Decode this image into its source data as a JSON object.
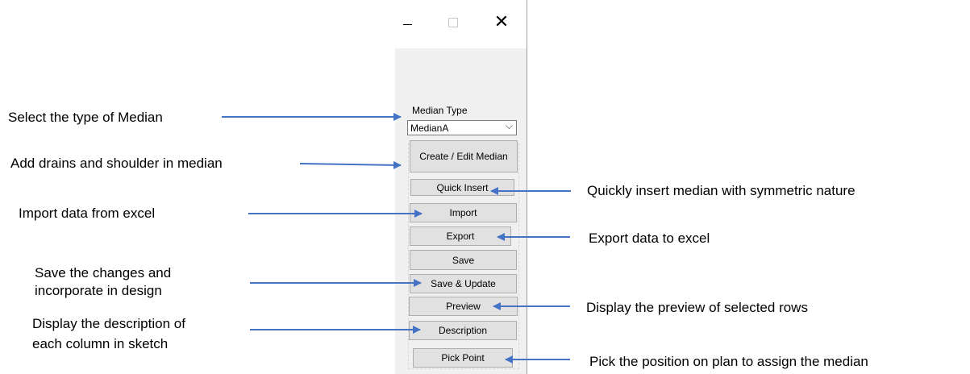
{
  "window": {
    "title_controls": {
      "minimize": "–",
      "maximize": "□",
      "close": "✕"
    },
    "median_type_label": "Median Type",
    "median_type_value": "MedianA",
    "buttons": {
      "create_edit": "Create / Edit Median",
      "quick_insert": "Quick Insert",
      "import": "Import",
      "export": "Export",
      "save": "Save",
      "save_update": "Save & Update",
      "preview": "Preview",
      "description": "Description",
      "pick_point": "Pick Point"
    }
  },
  "annotations": {
    "select_type": "Select the type of Median",
    "add_drains": "Add drains and shoulder in median",
    "import_excel": "Import data from excel",
    "save_line1": "Save the changes and",
    "save_line2": "incorporate in design",
    "desc_line1": "Display the description of",
    "desc_line2": "each column in sketch",
    "quick_insert": "Quickly insert median with symmetric nature",
    "export_excel": "Export data to excel",
    "preview": "Display the preview of selected rows",
    "pick_point": "Pick the position on plan to assign the median"
  },
  "colors": {
    "arrow": "#4472c4"
  }
}
